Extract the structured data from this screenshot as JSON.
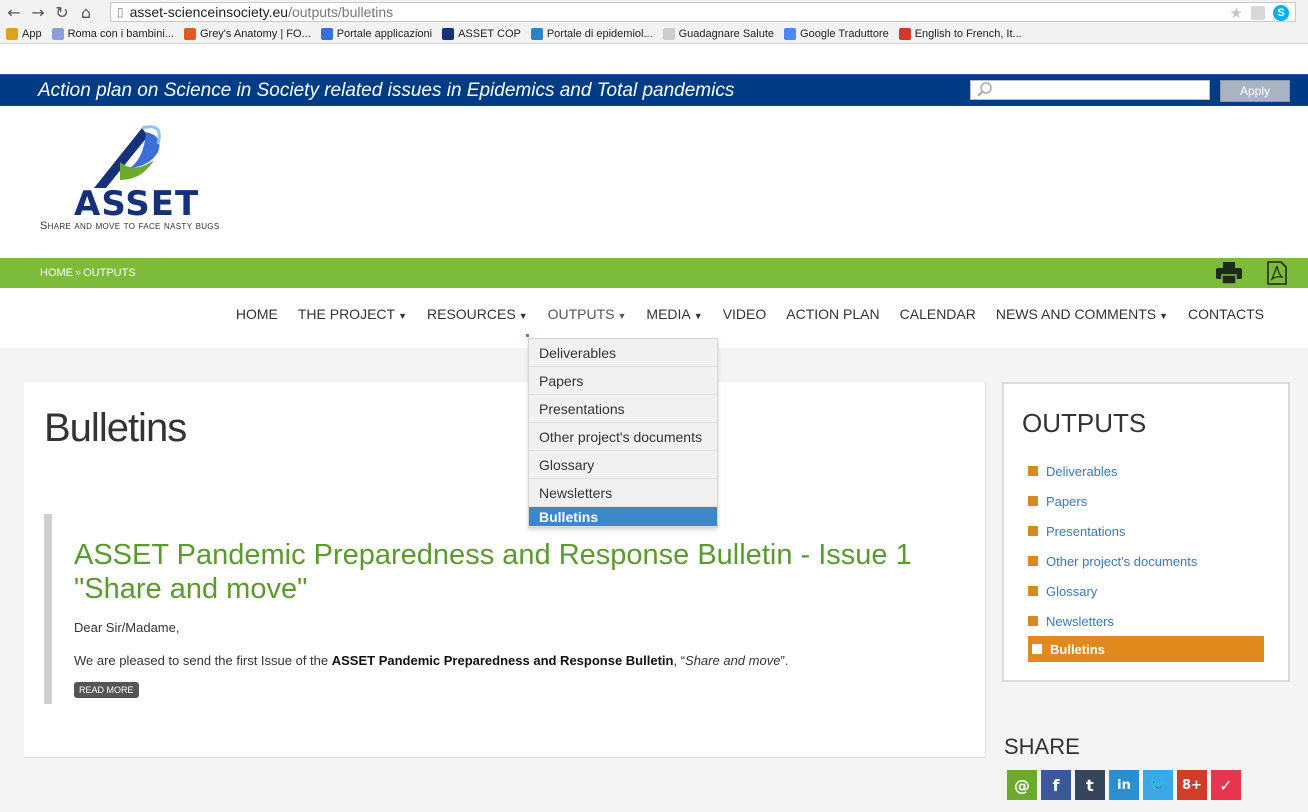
{
  "browser": {
    "url_host": "asset-scienceinsociety.eu",
    "url_path": "/outputs/bulletins",
    "bookmarks": [
      {
        "label": "App",
        "color": "#e0a020"
      },
      {
        "label": "Roma con i bambini...",
        "color": "#8aa0d8"
      },
      {
        "label": "Grey's Anatomy | FO...",
        "color": "#e05a1e"
      },
      {
        "label": "Portale applicazioni",
        "color": "#3b6fd8"
      },
      {
        "label": "ASSET COP",
        "color": "#17307a"
      },
      {
        "label": "Portale di epidemiol...",
        "color": "#2a82c8"
      },
      {
        "label": "Guadagnare Salute",
        "color": "#cccccc"
      },
      {
        "label": "Google Traduttore",
        "color": "#4a8af4"
      },
      {
        "label": "English to French, It...",
        "color": "#d03a2a"
      }
    ]
  },
  "header": {
    "tagline": "Action plan on Science in Society related issues in Epidemics and Total pandemics",
    "search_placeholder": "",
    "apply_label": "Apply"
  },
  "logo": {
    "name": "ASSET",
    "subtitle": "Share and move to face nasty bugs"
  },
  "breadcrumb": {
    "home": "HOME",
    "separator": "»",
    "current": "OUTPUTS"
  },
  "nav": {
    "items": [
      {
        "label": "HOME",
        "caret": false
      },
      {
        "label": "THE PROJECT",
        "caret": true
      },
      {
        "label": "RESOURCES",
        "caret": true
      },
      {
        "label": "OUTPUTS",
        "caret": true
      },
      {
        "label": "MEDIA",
        "caret": true
      },
      {
        "label": "VIDEO",
        "caret": false
      },
      {
        "label": "ACTION PLAN",
        "caret": false
      },
      {
        "label": "CALENDAR",
        "caret": false
      },
      {
        "label": "NEWS AND COMMENTS",
        "caret": true
      },
      {
        "label": "CONTACTS",
        "caret": false
      }
    ],
    "dropdown": [
      "Deliverables",
      "Papers",
      "Presentations",
      "Other project's documents",
      "Glossary",
      "Newsletters",
      "Bulletins"
    ]
  },
  "main": {
    "title": "Bulletins",
    "article": {
      "title": "ASSET Pandemic Preparedness and Response Bulletin - Issue 1 \"Share and move\"",
      "greeting": "Dear Sir/Madame,",
      "body_prefix": "We are pleased to send the first Issue of the ",
      "body_bold": "ASSET Pandemic Preparedness and Response Bulletin",
      "body_mid": ", “",
      "body_italic": "Share and move",
      "body_suffix": "”.",
      "read_more": "READ MORE"
    }
  },
  "sidebar": {
    "title": "OUTPUTS",
    "items": [
      "Deliverables",
      "Papers",
      "Presentations",
      "Other project's documents",
      "Glossary",
      "Newsletters",
      "Bulletins"
    ],
    "active": "Bulletins"
  },
  "share": {
    "title": "SHARE",
    "buttons": [
      {
        "name": "email",
        "glyph": "@",
        "color": "#6aab2e"
      },
      {
        "name": "facebook",
        "glyph": "f",
        "color": "#3b5998"
      },
      {
        "name": "tumblr",
        "glyph": "t",
        "color": "#35465c"
      },
      {
        "name": "linkedin",
        "glyph": "in",
        "color": "#2a8fd0"
      },
      {
        "name": "twitter",
        "glyph": "🐦",
        "color": "#3aa9e8"
      },
      {
        "name": "googleplus",
        "glyph": "8+",
        "color": "#d23c2a"
      },
      {
        "name": "pocket",
        "glyph": "✓",
        "color": "#e8354e"
      }
    ]
  },
  "colors": {
    "topbar": "#003c85",
    "green": "#7dbb3a",
    "accent_orange": "#e08a1e",
    "link_blue": "#3b78b8"
  }
}
